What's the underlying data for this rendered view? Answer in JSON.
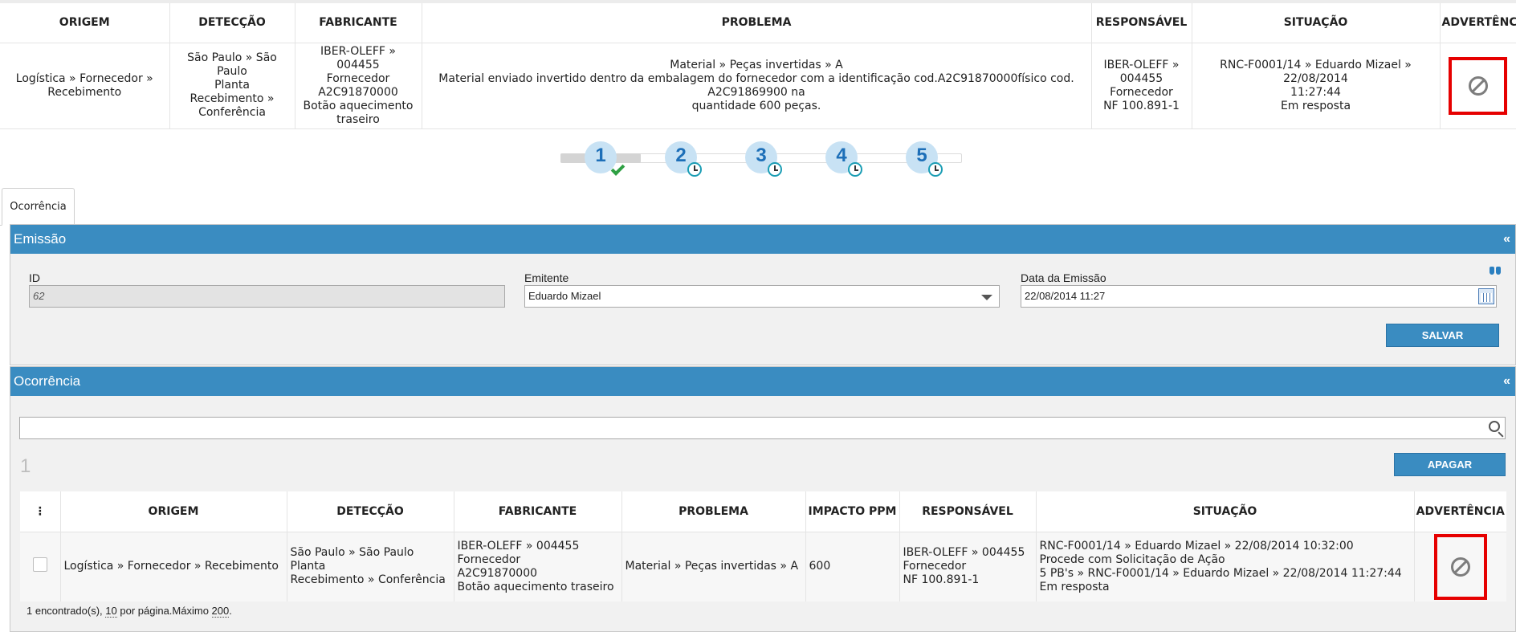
{
  "summary": {
    "headers": [
      "ORIGEM",
      "DETECÇÃO",
      "FABRICANTE",
      "PROBLEMA",
      "RESPONSÁVEL",
      "SITUAÇÃO",
      "ADVERTÊNCIA"
    ],
    "row": {
      "origem": "Logística » Fornecedor »\nRecebimento",
      "deteccao": "São Paulo » São Paulo\nPlanta\nRecebimento »\nConferência",
      "fabricante": "IBER-OLEFF » 004455\nFornecedor\nA2C91870000\nBotão aquecimento\ntraseiro",
      "problema": "Material » Peças invertidas » A\nMaterial enviado invertido dentro da embalagem do fornecedor com a identificação cod.A2C91870000físico cod. A2C91869900 na\nquantidade 600 peças.",
      "responsavel": "IBER-OLEFF »\n004455\nFornecedor\nNF 100.891-1",
      "situacao": "RNC-F0001/14 » Eduardo Mizael » 22/08/2014\n11:27:44\nEm resposta"
    }
  },
  "steps": [
    {
      "num": "1",
      "status": "done"
    },
    {
      "num": "2",
      "status": "pending"
    },
    {
      "num": "3",
      "status": "pending"
    },
    {
      "num": "4",
      "status": "pending"
    },
    {
      "num": "5",
      "status": "pending"
    }
  ],
  "tabs": [
    {
      "label": "Ocorrência"
    }
  ],
  "emissao": {
    "title": "Emissão",
    "collapse": "«",
    "id_label": "ID",
    "id_value": "62",
    "emitente_label": "Emitente",
    "emitente_value": "Eduardo Mizael",
    "data_label": "Data da Emissão",
    "data_value": "22/08/2014 11:27",
    "save_label": "SALVAR"
  },
  "ocorrencia": {
    "title": "Ocorrência",
    "collapse": "«",
    "search_value": "",
    "count": "1",
    "delete_label": "APAGAR",
    "grid": {
      "menu": "⋮",
      "headers": [
        "ORIGEM",
        "DETECÇÃO",
        "FABRICANTE",
        "PROBLEMA",
        "IMPACTO PPM",
        "RESPONSÁVEL",
        "SITUAÇÃO",
        "ADVERTÊNCIA"
      ],
      "row": {
        "origem": "Logística » Fornecedor » Recebimento",
        "deteccao": "São Paulo » São Paulo\nPlanta\nRecebimento » Conferência",
        "fabricante": "IBER-OLEFF » 004455\nFornecedor\nA2C91870000\nBotão aquecimento traseiro",
        "problema": "Material » Peças invertidas » A",
        "impacto": "600",
        "responsavel": "IBER-OLEFF » 004455\nFornecedor\nNF 100.891-1",
        "situacao": "RNC-F0001/14 » Eduardo Mizael » 22/08/2014 10:32:00\nProcede com Solicitação de Ação\n5 PB's » RNC-F0001/14 » Eduardo Mizael » 22/08/2014 11:27:44\nEm resposta"
      }
    },
    "footer": {
      "found": "1 encontrado(s), ",
      "per_page_num": "10",
      "per_page_text": " por página.Máximo ",
      "max_num": "200",
      "end": "."
    }
  }
}
